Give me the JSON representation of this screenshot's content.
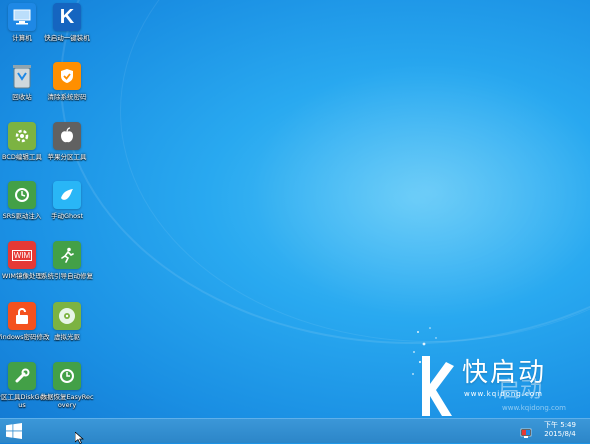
{
  "desktop": {
    "icons": [
      {
        "label": "计算机",
        "icon": "computer-icon",
        "color": "#1e88e5"
      },
      {
        "label": "快启动一键装机",
        "icon": "kqd-logo-icon",
        "color": "#1565c0"
      },
      {
        "label": "回收站",
        "icon": "recycle-bin-icon",
        "color": "#78909c"
      },
      {
        "label": "清除系统密码",
        "icon": "shield-icon",
        "color": "#ff8f00"
      },
      {
        "label": "BCD编辑工具",
        "icon": "gear-icon",
        "color": "#7cb342"
      },
      {
        "label": "苹果分区工具",
        "icon": "apple-icon",
        "color": "#616161"
      },
      {
        "label": "SRS驱动注入",
        "icon": "clock-arrow-icon",
        "color": "#43a047"
      },
      {
        "label": "手动Ghost",
        "icon": "ghost-bird-icon",
        "color": "#29b6f6"
      },
      {
        "label": "WIM镜像处理",
        "icon": "wim-icon",
        "color": "#e53935"
      },
      {
        "label": "系统引导自动修复",
        "icon": "running-man-icon",
        "color": "#43a047"
      },
      {
        "label": "Windows密码修改",
        "icon": "unlock-icon",
        "color": "#f4511e"
      },
      {
        "label": "虚拟光驱",
        "icon": "disc-icon",
        "color": "#7cb342"
      },
      {
        "label": "分区工具DiskGenius",
        "icon": "wrench-icon",
        "color": "#43a047"
      },
      {
        "label": "数据恢复EasyRecovery",
        "icon": "recovery-icon",
        "color": "#43a047"
      }
    ]
  },
  "brand": {
    "name": "快启动",
    "url": "www.kqidong.com",
    "ghost_name": "启动",
    "ghost_url": "www.kqidong.com"
  },
  "taskbar": {
    "time": "下午 5:49",
    "date": "2015/8/4"
  }
}
